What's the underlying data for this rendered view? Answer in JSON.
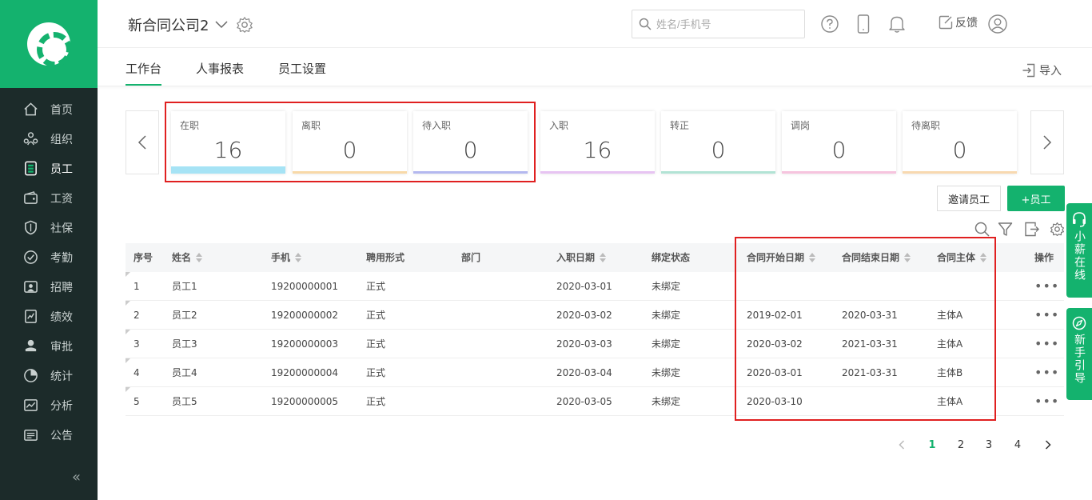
{
  "sidebar": {
    "items": [
      {
        "label": "首页",
        "icon": "home-icon"
      },
      {
        "label": "组织",
        "icon": "organization-icon"
      },
      {
        "label": "员工",
        "icon": "employee-icon"
      },
      {
        "label": "工资",
        "icon": "wallet-icon"
      },
      {
        "label": "社保",
        "icon": "shield-icon"
      },
      {
        "label": "考勤",
        "icon": "attendance-icon"
      },
      {
        "label": "招聘",
        "icon": "recruit-icon"
      },
      {
        "label": "绩效",
        "icon": "performance-icon"
      },
      {
        "label": "审批",
        "icon": "approval-icon"
      },
      {
        "label": "统计",
        "icon": "pie-chart-icon"
      },
      {
        "label": "分析",
        "icon": "analysis-icon"
      },
      {
        "label": "公告",
        "icon": "announcement-icon"
      }
    ],
    "active_index": 2,
    "collapse_label": "«"
  },
  "header": {
    "company": "新合同公司2",
    "search_placeholder": "姓名/手机号",
    "feedback": "反馈"
  },
  "tabs": {
    "items": [
      "工作台",
      "人事报表",
      "员工设置"
    ],
    "active": "工作台",
    "import_label": "导入"
  },
  "stats": [
    {
      "label": "在职",
      "value": "16",
      "color": "#a6e3f5"
    },
    {
      "label": "离职",
      "value": "0",
      "color": "#f8d9a8"
    },
    {
      "label": "待入职",
      "value": "0",
      "color": "#b4b8ef"
    },
    {
      "label": "入职",
      "value": "16",
      "color": "#e7c4f2"
    },
    {
      "label": "转正",
      "value": "0",
      "color": "#b2e3d5"
    },
    {
      "label": "调岗",
      "value": "0",
      "color": "#f6c4de"
    },
    {
      "label": "待离职",
      "value": "0",
      "color": "#f8d9b0"
    }
  ],
  "actions": {
    "invite": "邀请员工",
    "add": "+员工"
  },
  "table": {
    "headers": [
      "序号",
      "姓名",
      "手机",
      "聘用形式",
      "部门",
      "入职日期",
      "绑定状态",
      "合同开始日期",
      "合同结束日期",
      "合同主体",
      "操作"
    ],
    "rows": [
      [
        "1",
        "员工1",
        "19200000001",
        "正式",
        "",
        "2020-03-01",
        "未绑定",
        "",
        "",
        ""
      ],
      [
        "2",
        "员工2",
        "19200000002",
        "正式",
        "",
        "2020-03-02",
        "未绑定",
        "2019-02-01",
        "2020-03-31",
        "主体A"
      ],
      [
        "3",
        "员工3",
        "19200000003",
        "正式",
        "",
        "2020-03-03",
        "未绑定",
        "2020-03-02",
        "2021-03-31",
        "主体A"
      ],
      [
        "4",
        "员工4",
        "19200000004",
        "正式",
        "",
        "2020-03-04",
        "未绑定",
        "2020-03-01",
        "2021-03-31",
        "主体B"
      ],
      [
        "5",
        "员工5",
        "19200000005",
        "正式",
        "",
        "2020-03-05",
        "未绑定",
        "2020-03-10",
        "",
        "主体A"
      ]
    ],
    "more_label": "•••"
  },
  "pagination": {
    "pages": [
      "1",
      "2",
      "3",
      "4"
    ],
    "current": "1"
  },
  "floating": {
    "online": "小薪在线",
    "guide": "新手引导"
  },
  "colors": {
    "brand": "#14b26e",
    "sidebar_bg": "#1c2b2a",
    "highlight": "#e02020"
  }
}
